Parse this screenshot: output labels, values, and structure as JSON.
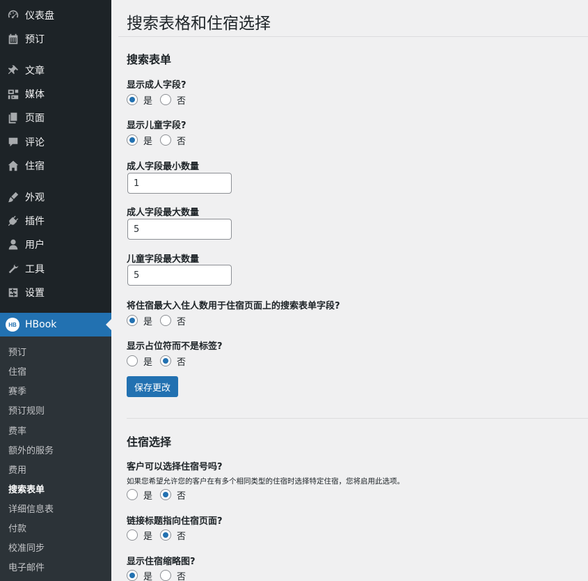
{
  "sidebar": {
    "items": [
      {
        "label": "仪表盘",
        "icon": "dashboard-icon"
      },
      {
        "label": "预订",
        "icon": "calendar-icon"
      },
      {
        "label": "文章",
        "icon": "pin-icon"
      },
      {
        "label": "媒体",
        "icon": "media-icon"
      },
      {
        "label": "页面",
        "icon": "page-icon"
      },
      {
        "label": "评论",
        "icon": "comment-icon"
      },
      {
        "label": "住宿",
        "icon": "home-icon"
      },
      {
        "label": "外观",
        "icon": "brush-icon"
      },
      {
        "label": "插件",
        "icon": "plugin-icon"
      },
      {
        "label": "用户",
        "icon": "user-icon"
      },
      {
        "label": "工具",
        "icon": "wrench-icon"
      },
      {
        "label": "设置",
        "icon": "settings-icon"
      }
    ],
    "hbook": {
      "badge": "HB",
      "label": "HBook"
    },
    "submenu": [
      "预订",
      "住宿",
      "赛季",
      "预订规则",
      "费率",
      "额外的服务",
      "费用",
      "搜索表单",
      "详细信息表",
      "付款",
      "校准同步",
      "电子邮件"
    ],
    "current": "搜索表单"
  },
  "page": {
    "title": "搜索表格和住宿选择",
    "search_form": {
      "heading": "搜索表单",
      "show_adults": {
        "label": "显示成人字段?",
        "yes": "是",
        "no": "否",
        "value": "yes"
      },
      "show_children": {
        "label": "显示儿童字段?",
        "yes": "是",
        "no": "否",
        "value": "yes"
      },
      "adults_min": {
        "label": "成人字段最小数量",
        "value": "1"
      },
      "adults_max": {
        "label": "成人字段最大数量",
        "value": "5"
      },
      "children_max": {
        "label": "儿童字段最大数量",
        "value": "5"
      },
      "use_max_occupancy": {
        "label": "将住宿最大入住人数用于住宿页面上的搜索表单字段?",
        "yes": "是",
        "no": "否",
        "value": "yes"
      },
      "placeholders": {
        "label": "显示占位符而不是标签?",
        "yes": "是",
        "no": "否",
        "value": "no"
      },
      "save_label": "保存更改"
    },
    "accom_selection": {
      "heading": "住宿选择",
      "select_number": {
        "label": "客户可以选择住宿号吗?",
        "desc": "如果您希望允许您的客户在有多个相同类型的住宿时选择特定住宿，您将启用此选项。",
        "yes": "是",
        "no": "否",
        "value": "no"
      },
      "link_title": {
        "label": "链接标题指向住宿页面?",
        "yes": "是",
        "no": "否",
        "value": "no"
      },
      "show_thumb": {
        "label": "显示住宿缩略图?",
        "yes": "是",
        "no": "否",
        "value": "yes"
      }
    }
  },
  "colors": {
    "accent": "#2271b1",
    "sidebar_bg": "#1d2327",
    "submenu_bg": "#2c3338",
    "page_bg": "#f0f0f1"
  }
}
